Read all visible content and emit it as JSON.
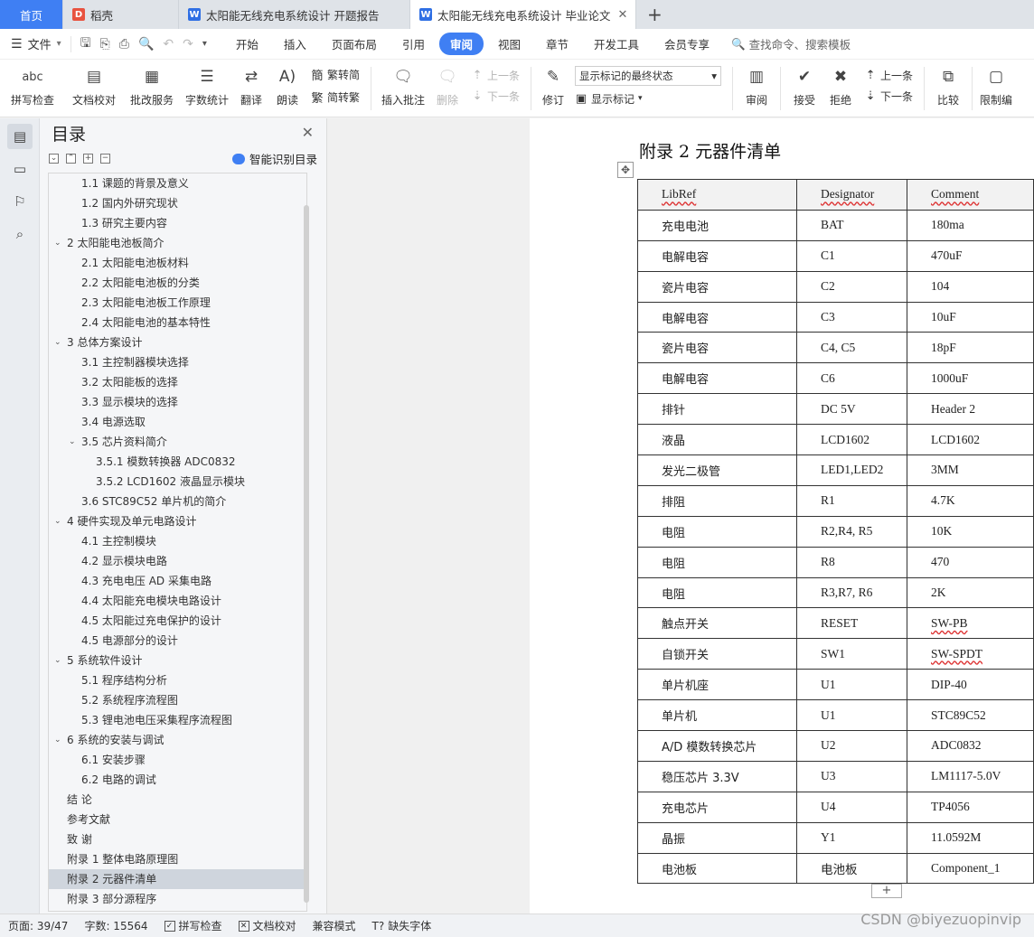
{
  "tabs": {
    "home": "首页",
    "t1": "稻壳",
    "t2": "太阳能无线充电系统设计 开题报告",
    "t3": "太阳能无线充电系统设计 毕业论文",
    "add": "+"
  },
  "menu": {
    "file": "文件",
    "tabs": [
      "开始",
      "插入",
      "页面布局",
      "引用",
      "审阅",
      "视图",
      "章节",
      "开发工具",
      "会员专享"
    ],
    "active_tab": "审阅",
    "search": "查找命令、搜索模板"
  },
  "ribbon": {
    "spell": "拼写检查",
    "proof": "文档校对",
    "approve": "批改服务",
    "wordcount": "字数统计",
    "translate": "翻译",
    "read": "朗读",
    "to_trad": "繁转简",
    "to_simp": "简转繁",
    "insert_comment": "插入批注",
    "delete": "删除",
    "prev": "上一条",
    "next": "下一条",
    "revise": "修订",
    "markup_state": "显示标记的最终状态",
    "show_markup": "显示标记",
    "review": "审阅",
    "accept": "接受",
    "reject": "拒绝",
    "prev2": "上一条",
    "next2": "下一条",
    "compare": "比较",
    "restrict": "限制编"
  },
  "toc": {
    "title": "目录",
    "smart": "智能识别目录",
    "items": [
      {
        "label": "1.1 课题的背景及意义",
        "level": 2
      },
      {
        "label": "1.2 国内外研究现状",
        "level": 2
      },
      {
        "label": "1.3 研究主要内容",
        "level": 2
      },
      {
        "label": "2  太阳能电池板简介",
        "level": 1,
        "expanded": true
      },
      {
        "label": "2.1 太阳能电池板材料",
        "level": 2
      },
      {
        "label": "2.2 太阳能电池板的分类",
        "level": 2
      },
      {
        "label": "2.3 太阳能电池板工作原理",
        "level": 2
      },
      {
        "label": "2.4 太阳能电池的基本特性",
        "level": 2
      },
      {
        "label": "3  总体方案设计",
        "level": 1,
        "expanded": true
      },
      {
        "label": "3.1 主控制器模块选择",
        "level": 2
      },
      {
        "label": "3.2 太阳能板的选择",
        "level": 2
      },
      {
        "label": "3.3 显示模块的选择",
        "level": 2
      },
      {
        "label": "3.4 电源选取",
        "level": 2
      },
      {
        "label": "3.5 芯片资料简介",
        "level": 2,
        "expanded": true
      },
      {
        "label": "3.5.1 模数转换器 ADC0832",
        "level": 3
      },
      {
        "label": "3.5.2 LCD1602 液晶显示模块",
        "level": 3
      },
      {
        "label": "3.6 STC89C52 单片机的简介",
        "level": 2
      },
      {
        "label": "4  硬件实现及单元电路设计",
        "level": 1,
        "expanded": true
      },
      {
        "label": "4.1 主控制模块",
        "level": 2
      },
      {
        "label": "4.2 显示模块电路",
        "level": 2
      },
      {
        "label": "4.3 充电电压 AD 采集电路",
        "level": 2
      },
      {
        "label": "4.4 太阳能充电模块电路设计",
        "level": 2
      },
      {
        "label": "4.5 太阳能过充电保护的设计",
        "level": 2
      },
      {
        "label": "4.5 电源部分的设计",
        "level": 2
      },
      {
        "label": "5  系统软件设计",
        "level": 1,
        "expanded": true
      },
      {
        "label": "5.1 程序结构分析",
        "level": 2
      },
      {
        "label": "5.2 系统程序流程图",
        "level": 2
      },
      {
        "label": "5.3 锂电池电压采集程序流程图",
        "level": 2
      },
      {
        "label": "6  系统的安装与调试",
        "level": 1,
        "expanded": true
      },
      {
        "label": "6.1 安装步骤",
        "level": 2
      },
      {
        "label": "6.2 电路的调试",
        "level": 2
      },
      {
        "label": "结    论",
        "level": 0
      },
      {
        "label": "参考文献",
        "level": 0
      },
      {
        "label": "致    谢",
        "level": 0
      },
      {
        "label": "附录 1 整体电路原理图",
        "level": 0
      },
      {
        "label": "附录 2 元器件清单",
        "level": 0,
        "selected": true
      },
      {
        "label": "附录 3 部分源程序",
        "level": 0
      }
    ]
  },
  "doc": {
    "heading": "附录 2 元器件清单",
    "columns": [
      "LibRef",
      "Designator",
      "Comment"
    ],
    "rows": [
      [
        "充电电池",
        "BAT",
        "180ma"
      ],
      [
        "电解电容",
        "C1",
        "470uF"
      ],
      [
        "瓷片电容",
        "C2",
        "104"
      ],
      [
        "电解电容",
        "C3",
        "10uF"
      ],
      [
        "瓷片电容",
        "C4, C5",
        "18pF"
      ],
      [
        "电解电容",
        "C6",
        "1000uF"
      ],
      [
        "排针",
        "DC 5V",
        "Header 2"
      ],
      [
        "液晶",
        "LCD1602",
        "LCD1602"
      ],
      [
        "发光二极管",
        "LED1,LED2",
        "3MM"
      ],
      [
        "排阻",
        "R1",
        "4.7K"
      ],
      [
        "电阻",
        "R2,R4, R5",
        "10K"
      ],
      [
        "电阻",
        "R8",
        "470"
      ],
      [
        "电阻",
        "R3,R7, R6",
        "2K"
      ],
      [
        "触点开关",
        "RESET",
        "SW-PB"
      ],
      [
        "自锁开关",
        "SW1",
        "SW-SPDT"
      ],
      [
        "单片机座",
        "U1",
        "DIP-40"
      ],
      [
        "单片机",
        "U1",
        "STC89C52"
      ],
      [
        "A/D 模数转换芯片",
        "U2",
        "ADC0832"
      ],
      [
        "稳压芯片 3.3V",
        "U3",
        "LM1117-5.0V"
      ],
      [
        "充电芯片",
        "U4",
        "TP4056"
      ],
      [
        "晶振",
        "Y1",
        "11.0592M"
      ],
      [
        "电池板",
        "电池板",
        "Component_1"
      ]
    ]
  },
  "status": {
    "page": "页面: 39/47",
    "words": "字数: 15564",
    "spell": "拼写检查",
    "proof": "文档校对",
    "compat": "兼容模式",
    "missing_font": "缺失字体"
  },
  "watermark": "CSDN @biyezuopinvip"
}
